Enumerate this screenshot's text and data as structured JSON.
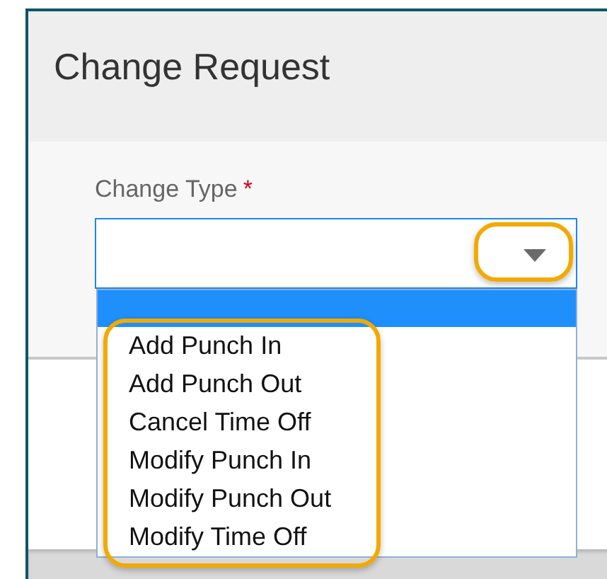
{
  "dialog": {
    "title": "Change Request"
  },
  "field": {
    "label": "Change Type",
    "required_mark": "*",
    "expanded": true,
    "blank_option": {
      "selected": true
    },
    "options": [
      {
        "label": "Add Punch In",
        "selected": false
      },
      {
        "label": "Add Punch Out",
        "selected": false
      },
      {
        "label": "Cancel Time Off",
        "selected": false
      },
      {
        "label": "Modify Punch In",
        "selected": false
      },
      {
        "label": "Modify Punch Out",
        "selected": false
      },
      {
        "label": "Modify Time Off",
        "selected": false
      }
    ]
  }
}
